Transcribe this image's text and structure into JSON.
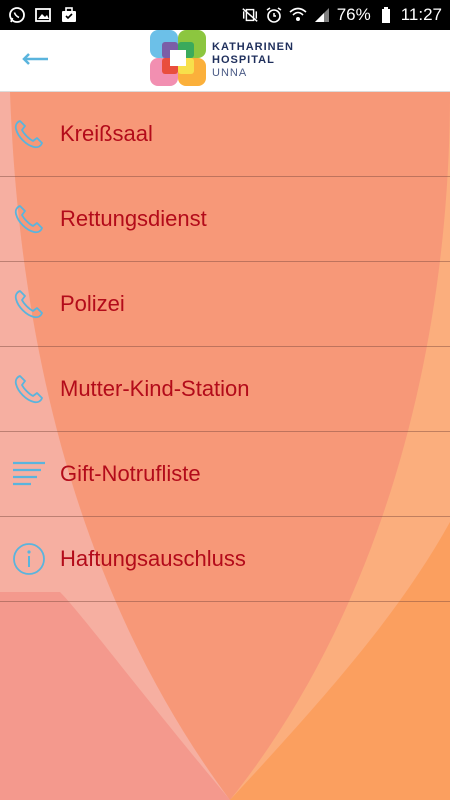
{
  "status_bar": {
    "battery": "76%",
    "time": "11:27",
    "left_icons": [
      "whatsapp-icon",
      "image-icon",
      "briefcase-icon"
    ],
    "right_icons": [
      "vibrate-icon",
      "alarm-icon",
      "wifi-icon",
      "signal-icon",
      "battery-icon"
    ]
  },
  "header": {
    "back_icon": "back-arrow-icon",
    "logo": {
      "line1": "KATHARINEN",
      "line2": "HOSPITAL",
      "line3": "UNNA"
    }
  },
  "menu": {
    "items": [
      {
        "label": "Kreißsaal",
        "icon": "phone-icon"
      },
      {
        "label": "Rettungsdienst",
        "icon": "phone-icon"
      },
      {
        "label": "Polizei",
        "icon": "phone-icon"
      },
      {
        "label": "Mutter-Kind-Station",
        "icon": "phone-icon"
      },
      {
        "label": "Gift-Notrufliste",
        "icon": "list-icon"
      },
      {
        "label": "Haftungsauschluss",
        "icon": "info-icon"
      }
    ]
  },
  "colors": {
    "label": "#b30b1a",
    "icon": "#5ab4dd",
    "bg_left": "#f48a80",
    "bg_right": "#fba15a",
    "overlap": "#f07257"
  }
}
